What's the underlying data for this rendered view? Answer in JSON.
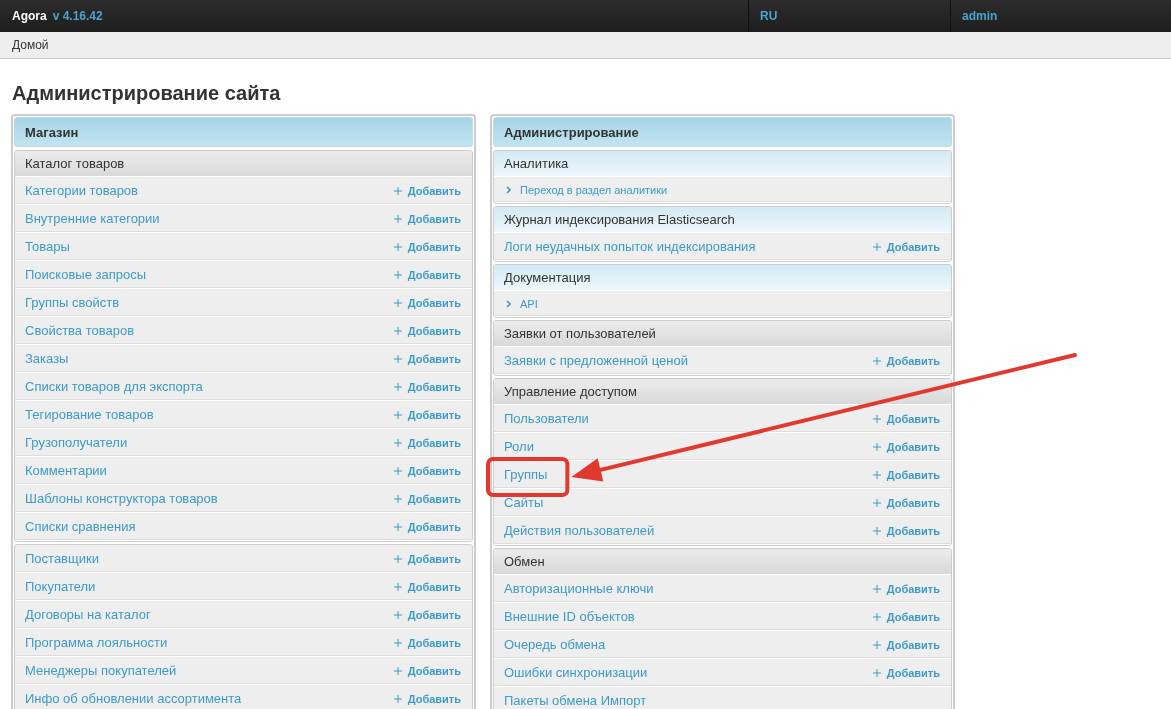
{
  "header": {
    "brand": "Agora",
    "version": "v 4.16.42",
    "language": "RU",
    "user": "admin"
  },
  "breadcrumbs": [
    "Домой"
  ],
  "title": "Администрирование сайта",
  "panels": [
    {
      "title": "Магазин",
      "groups": [
        {
          "title": "Каталог товаров",
          "kind": "plain",
          "rows": [
            {
              "kind": "model",
              "label": "Категории товаров",
              "add": "Добавить",
              "callout": false
            },
            {
              "kind": "model",
              "label": "Внутренние категории",
              "add": "Добавить",
              "callout": false
            },
            {
              "kind": "model",
              "label": "Товары",
              "add": "Добавить",
              "callout": false
            },
            {
              "kind": "model",
              "label": "Поисковые запросы",
              "add": "Добавить",
              "callout": false
            },
            {
              "kind": "model",
              "label": "Группы свойств",
              "add": "Добавить",
              "callout": false
            },
            {
              "kind": "model",
              "label": "Свойства товаров",
              "add": "Добавить",
              "callout": false
            },
            {
              "kind": "model",
              "label": "Заказы",
              "add": "Добавить",
              "callout": false
            },
            {
              "kind": "model",
              "label": "Списки товаров для экспорта",
              "add": "Добавить",
              "callout": false
            },
            {
              "kind": "model",
              "label": "Тегирование товаров",
              "add": "Добавить",
              "callout": false
            },
            {
              "kind": "model",
              "label": "Грузополучатели",
              "add": "Добавить",
              "callout": false
            },
            {
              "kind": "model",
              "label": "Комментарии",
              "add": "Добавить",
              "callout": false
            },
            {
              "kind": "model",
              "label": "Шаблоны конструктора товаров",
              "add": "Добавить",
              "callout": false
            },
            {
              "kind": "model",
              "label": "Списки сравнения",
              "add": "Добавить",
              "callout": false
            }
          ]
        },
        {
          "rows": [
            {
              "kind": "model",
              "label": "Поставщики",
              "add": "Добавить",
              "callout": false
            },
            {
              "kind": "model",
              "label": "Покупатели",
              "add": "Добавить",
              "callout": false
            },
            {
              "kind": "model",
              "label": "Договоры на каталог",
              "add": "Добавить",
              "callout": false
            },
            {
              "kind": "model",
              "label": "Программа лояльности",
              "add": "Добавить",
              "callout": false
            },
            {
              "kind": "model",
              "label": "Менеджеры покупателей",
              "add": "Добавить",
              "callout": false
            },
            {
              "kind": "model",
              "label": "Инфо об обновлении ассортимента",
              "add": "Добавить",
              "callout": false
            }
          ]
        }
      ]
    },
    {
      "title": "Администрирование",
      "groups": [
        {
          "title": "Аналитика",
          "kind": "highlighted",
          "rows": [
            {
              "kind": "link",
              "label": "Переход в раздел аналитики",
              "callout": false
            }
          ]
        },
        {
          "title": "Журнал индексирования Elasticsearch",
          "kind": "highlighted",
          "rows": [
            {
              "kind": "model",
              "label": "Логи неудачных попыток индексирования",
              "add": "Добавить",
              "callout": false
            }
          ]
        },
        {
          "title": "Документация",
          "kind": "highlighted",
          "rows": [
            {
              "kind": "link",
              "label": "API",
              "callout": false
            }
          ]
        },
        {
          "title": "Заявки от пользователей",
          "kind": "plain",
          "rows": [
            {
              "kind": "model",
              "label": "Заявки с предложенной ценой",
              "add": "Добавить",
              "callout": false
            }
          ]
        },
        {
          "title": "Управление доступом",
          "kind": "plain",
          "rows": [
            {
              "kind": "model",
              "label": "Пользователи",
              "add": "Добавить",
              "callout": false
            },
            {
              "kind": "model",
              "label": "Роли",
              "add": "Добавить",
              "callout": false
            },
            {
              "kind": "model",
              "label": "Группы",
              "add": "Добавить",
              "callout": true
            },
            {
              "kind": "model",
              "label": "Сайты",
              "add": "Добавить",
              "callout": false
            },
            {
              "kind": "model",
              "label": "Действия пользователей",
              "add": "Добавить",
              "callout": false
            }
          ]
        },
        {
          "title": "Обмен",
          "kind": "plain",
          "rows": [
            {
              "kind": "model",
              "label": "Авторизационные ключи",
              "add": "Добавить",
              "callout": false
            },
            {
              "kind": "model",
              "label": "Внешние ID объектов",
              "add": "Добавить",
              "callout": false
            },
            {
              "kind": "model",
              "label": "Очередь обмена",
              "add": "Добавить",
              "callout": false
            },
            {
              "kind": "model",
              "label": "Ошибки синхронизации",
              "add": "Добавить",
              "callout": false
            },
            {
              "kind": "model",
              "label": "Пакеты обмена Импорт",
              "callout": false
            }
          ]
        }
      ]
    }
  ]
}
